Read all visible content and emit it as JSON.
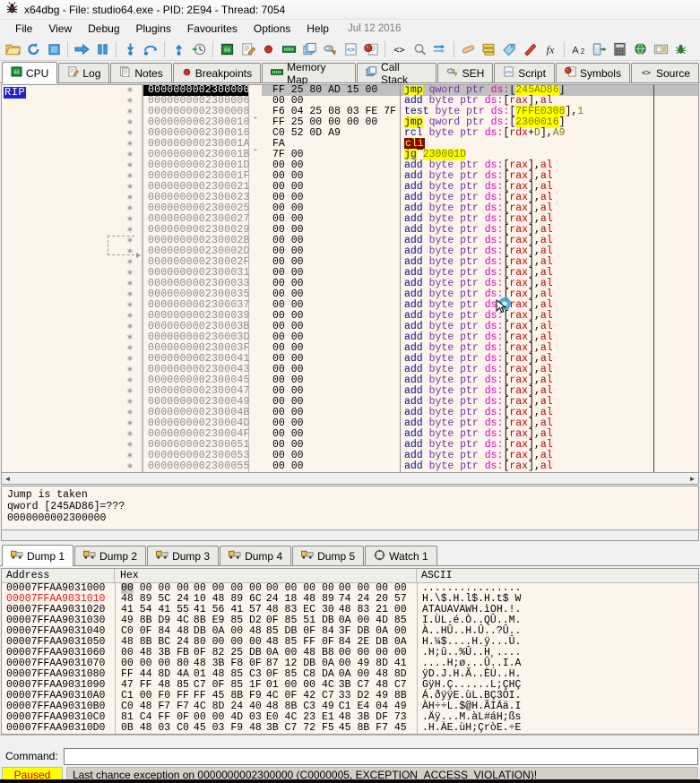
{
  "window": {
    "icon": "bug-icon",
    "title": "x64dbg - File: studio64.exe - PID: 2E94 - Thread: 7054"
  },
  "menu": {
    "items": [
      "File",
      "View",
      "Debug",
      "Plugins",
      "Favourites",
      "Options",
      "Help"
    ],
    "date": "Jul 12 2016"
  },
  "toolbar": {
    "groups": [
      [
        "open-icon",
        "restart-icon",
        "stop-icon"
      ],
      [
        "run-icon",
        "pause-icon"
      ],
      [
        "step-into-icon",
        "step-over-icon"
      ],
      [
        "step-out-icon",
        "run-to-icon"
      ],
      [
        "cpu-icon",
        "log-icon",
        "breakpoints-icon",
        "memory-map-icon",
        "call-stack-icon",
        "seh-icon",
        "script-icon",
        "symbols-icon"
      ],
      [
        "source-icon",
        "references-icon",
        "threads-icon"
      ],
      [
        "patches-icon",
        "comments-icon",
        "labels-icon",
        "bookmarks-icon",
        "functions-icon"
      ],
      [
        "variables-icon",
        "appearance-icon",
        "calculator-icon",
        "web-icon",
        "notes-icon",
        "plugin-icon"
      ]
    ]
  },
  "main_tabs": [
    {
      "label": "CPU",
      "icon": "cpu-icon",
      "active": true
    },
    {
      "label": "Log",
      "icon": "log-icon",
      "active": false
    },
    {
      "label": "Notes",
      "icon": "notes-icon",
      "active": false
    },
    {
      "label": "Breakpoints",
      "icon": "breakpoint-icon",
      "active": false
    },
    {
      "label": "Memory Map",
      "icon": "memory-map-icon",
      "active": false
    },
    {
      "label": "Call Stack",
      "icon": "call-stack-icon",
      "active": false
    },
    {
      "label": "SEH",
      "icon": "seh-icon",
      "active": false
    },
    {
      "label": "Script",
      "icon": "script-icon",
      "active": false
    },
    {
      "label": "Symbols",
      "icon": "symbols-icon",
      "active": false
    },
    {
      "label": "Source",
      "icon": "source-icon",
      "active": false
    }
  ],
  "disassembly": {
    "rip_label": "RIP",
    "rows": [
      {
        "addr": "0000000002300000",
        "hex": "FF 25 80 AD 15 00",
        "selected": true,
        "chev": "",
        "ins_html": "<span class=\"mn-j\">jmp</span> <span class=\"kw\">qword ptr</span> <span class=\"seg\">ds:</span><span class=\"punct\">[</span><span class=\"hl\">245AD86</span><span class=\"punct\">]</span>"
      },
      {
        "addr": "0000000002300006",
        "hex": "00 00",
        "selected": false,
        "chev": "",
        "ins_html": "<span class=\"mn\">add</span> <span class=\"kw\">byte ptr</span> <span class=\"seg\">ds:</span><span class=\"punct\">[</span><span class=\"reg\">rax</span><span class=\"punct\">],</span><span class=\"reg\">al</span>"
      },
      {
        "addr": "0000000002300008",
        "hex": "F6 04 25 08 03 FE 7F",
        "selected": false,
        "chev": "",
        "ins_html": "<span class=\"mn\">test</span> <span class=\"kw\">byte ptr</span> <span class=\"seg\">ds:</span><span class=\"punct\">[</span><span class=\"hl\">7FFE0308</span><span class=\"punct\">],</span><span class=\"num\">1</span>"
      },
      {
        "addr": "0000000002300010",
        "hex": "FF 25 00 00 00 00",
        "selected": false,
        "chev": "v",
        "ins_html": "<span class=\"mn-j\">jmp</span> <span class=\"kw\">qword ptr</span> <span class=\"seg\">ds:</span><span class=\"punct\">[</span><span class=\"hl\">2300016</span><span class=\"punct\">]</span>"
      },
      {
        "addr": "0000000002300016",
        "hex": "C0 52 0D A9",
        "selected": false,
        "chev": "",
        "ins_html": "<span class=\"mn\">rcl</span> <span class=\"kw\">byte ptr</span> <span class=\"seg\">ds:</span><span class=\"punct\">[</span><span class=\"reg\">rdx</span><span class=\"punct\">+</span><span class=\"num\">D</span><span class=\"punct\">],</span><span class=\"num\">A9</span>"
      },
      {
        "addr": "000000000230001A",
        "hex": "FA",
        "selected": false,
        "chev": "",
        "ins_html": "<span class=\"cli\">cli</span>"
      },
      {
        "addr": "000000000230001B",
        "hex": "7F 00",
        "selected": false,
        "chev": "v",
        "ins_html": "<span class=\"jg\">jg</span> <span class=\"jgt\">230001D</span>"
      },
      {
        "addr": "000000000230001D",
        "hex": "00 00",
        "selected": false,
        "chev": "",
        "ins_html": "ADD"
      },
      {
        "addr": "000000000230001F",
        "hex": "00 00",
        "selected": false,
        "chev": "",
        "ins_html": "ADD"
      },
      {
        "addr": "0000000002300021",
        "hex": "00 00",
        "selected": false,
        "chev": "",
        "ins_html": "ADD"
      },
      {
        "addr": "0000000002300023",
        "hex": "00 00",
        "selected": false,
        "chev": "",
        "ins_html": "ADD"
      },
      {
        "addr": "0000000002300025",
        "hex": "00 00",
        "selected": false,
        "chev": "",
        "ins_html": "ADD"
      },
      {
        "addr": "0000000002300027",
        "hex": "00 00",
        "selected": false,
        "chev": "",
        "ins_html": "ADD"
      },
      {
        "addr": "0000000002300029",
        "hex": "00 00",
        "selected": false,
        "chev": "",
        "ins_html": "ADD"
      },
      {
        "addr": "000000000230002B",
        "hex": "00 00",
        "selected": false,
        "chev": "",
        "ins_html": "ADD"
      },
      {
        "addr": "000000000230002D",
        "hex": "00 00",
        "selected": false,
        "chev": "",
        "ins_html": "ADD"
      },
      {
        "addr": "000000000230002F",
        "hex": "00 00",
        "selected": false,
        "chev": "",
        "ins_html": "ADD"
      },
      {
        "addr": "0000000002300031",
        "hex": "00 00",
        "selected": false,
        "chev": "",
        "ins_html": "ADD"
      },
      {
        "addr": "0000000002300033",
        "hex": "00 00",
        "selected": false,
        "chev": "",
        "ins_html": "ADD"
      },
      {
        "addr": "0000000002300035",
        "hex": "00 00",
        "selected": false,
        "chev": "",
        "ins_html": "ADD"
      },
      {
        "addr": "0000000002300037",
        "hex": "00 00",
        "selected": false,
        "chev": "",
        "ins_html": "ADD"
      },
      {
        "addr": "0000000002300039",
        "hex": "00 00",
        "selected": false,
        "chev": "",
        "ins_html": "ADD"
      },
      {
        "addr": "000000000230003B",
        "hex": "00 00",
        "selected": false,
        "chev": "",
        "ins_html": "ADD"
      },
      {
        "addr": "000000000230003D",
        "hex": "00 00",
        "selected": false,
        "chev": "",
        "ins_html": "ADD"
      },
      {
        "addr": "000000000230003F",
        "hex": "00 00",
        "selected": false,
        "chev": "",
        "ins_html": "ADD"
      },
      {
        "addr": "0000000002300041",
        "hex": "00 00",
        "selected": false,
        "chev": "",
        "ins_html": "ADD"
      },
      {
        "addr": "0000000002300043",
        "hex": "00 00",
        "selected": false,
        "chev": "",
        "ins_html": "ADD"
      },
      {
        "addr": "0000000002300045",
        "hex": "00 00",
        "selected": false,
        "chev": "",
        "ins_html": "ADD"
      },
      {
        "addr": "0000000002300047",
        "hex": "00 00",
        "selected": false,
        "chev": "",
        "ins_html": "ADD"
      },
      {
        "addr": "0000000002300049",
        "hex": "00 00",
        "selected": false,
        "chev": "",
        "ins_html": "ADD"
      },
      {
        "addr": "000000000230004B",
        "hex": "00 00",
        "selected": false,
        "chev": "",
        "ins_html": "ADD"
      },
      {
        "addr": "000000000230004D",
        "hex": "00 00",
        "selected": false,
        "chev": "",
        "ins_html": "ADD"
      },
      {
        "addr": "000000000230004F",
        "hex": "00 00",
        "selected": false,
        "chev": "",
        "ins_html": "ADD"
      },
      {
        "addr": "0000000002300051",
        "hex": "00 00",
        "selected": false,
        "chev": "",
        "ins_html": "ADD"
      },
      {
        "addr": "0000000002300053",
        "hex": "00 00",
        "selected": false,
        "chev": "",
        "ins_html": "ADD"
      },
      {
        "addr": "0000000002300055",
        "hex": "00 00",
        "selected": false,
        "chev": "",
        "ins_html": "ADD"
      }
    ],
    "add_instruction_html": "<span class=\"mn\">add</span> <span class=\"kw\">byte ptr</span> <span class=\"seg\">ds:</span><span class=\"punct\">[</span><span class=\"reg\">rax</span><span class=\"punct\">],</span><span class=\"reg\">al</span>"
  },
  "info_panel": {
    "line1": "Jump is taken",
    "line2": "qword [245AD86]=???",
    "line3": "0000000002300000"
  },
  "dump_tabs": [
    {
      "label": "Dump 1",
      "icon": "dump-icon",
      "active": true
    },
    {
      "label": "Dump 2",
      "icon": "dump-icon",
      "active": false
    },
    {
      "label": "Dump 3",
      "icon": "dump-icon",
      "active": false
    },
    {
      "label": "Dump 4",
      "icon": "dump-icon",
      "active": false
    },
    {
      "label": "Dump 5",
      "icon": "dump-icon",
      "active": false
    },
    {
      "label": "Watch 1",
      "icon": "watch-icon",
      "active": false
    }
  ],
  "dump": {
    "headers": {
      "address": "Address",
      "hex": "Hex",
      "ascii": "ASCII"
    },
    "rows": [
      {
        "addr": "00007FFAA9031000",
        "red": false,
        "hex": [
          "00 00 00 00",
          "00 00 00 00",
          "00 00 00 00",
          "00 00 00 00"
        ],
        "ascii": "................"
      },
      {
        "addr": "00007FFAA9031010",
        "red": true,
        "hex": [
          "48 89 5C 24",
          "10 48 89 6C",
          "24 18 48 89",
          "74 24 20 57"
        ],
        "ascii": "H.\\$.H.l$.H.t$ W"
      },
      {
        "addr": "00007FFAA9031020",
        "red": false,
        "hex": [
          "41 54 41 55",
          "41 56 41 57",
          "48 83 EC 30",
          "48 83 21 00"
        ],
        "ascii": "ATAUAVAWH.ìOH.!."
      },
      {
        "addr": "00007FFAA9031030",
        "red": false,
        "hex": [
          "49 8B D9 4C",
          "8B E9 85 D2",
          "0F 85 51 DB",
          "0A 00 4D 85"
        ],
        "ascii": "I.ÙL.é.Ò..QÛ..M."
      },
      {
        "addr": "00007FFAA9031040",
        "red": false,
        "hex": [
          "C0 0F 84 48",
          "DB 0A 00 48",
          "85 DB 0F 84",
          "3F DB 0A 00"
        ],
        "ascii": "À..HÛ..H.Û..?Û.."
      },
      {
        "addr": "00007FFAA9031050",
        "red": false,
        "hex": [
          "48 8B BC 24",
          "80 00 00 00",
          "48 85 FF 0F",
          "84 2E DB 0A"
        ],
        "ascii": "H.¼$....H.ÿ...Û."
      },
      {
        "addr": "00007FFAA9031060",
        "red": false,
        "hex": [
          "00 48 3B FB",
          "0F 82 25 DB",
          "0A 00 48 B8",
          "00 00 00 00"
        ],
        "ascii": ".H;û..%Û..H¸...."
      },
      {
        "addr": "00007FFAA9031070",
        "red": false,
        "hex": [
          "00 00 00 80",
          "48 3B F8 0F",
          "87 12 DB 0A",
          "00 49 8D 41"
        ],
        "ascii": "....H;ø...Û..I.A"
      },
      {
        "addr": "00007FFAA9031080",
        "red": false,
        "hex": [
          "FF 44 8D 4A",
          "01 48 85 C3",
          "0F 85 C8 DA",
          "0A 00 48 8D"
        ],
        "ascii": "ÿD.J.H.Ã..ÈÚ..H."
      },
      {
        "addr": "00007FFAA9031090",
        "red": false,
        "hex": [
          "47 FF 48 85",
          "C7 0F 85 1F",
          "01 00 00 4C",
          "3B C7 48 C7"
        ],
        "ascii": "GÿH.Ç......L;ÇHÇ"
      },
      {
        "addr": "00007FFAA90310A0",
        "red": false,
        "hex": [
          "C1 00 F0 FF",
          "FF 45 8B F9",
          "4C 0F 42 C7",
          "33 D2 49 8B"
        ],
        "ascii": "Á.ðÿÿE.ùL.BÇ3ÒI."
      },
      {
        "addr": "00007FFAA90310B0",
        "red": false,
        "hex": [
          "C0 48 F7 F7",
          "4C 8D 24 40",
          "48 8B C3 49",
          "C1 E4 04 49"
        ],
        "ascii": "ÀH÷÷L.$@H.ÃIÁä.I"
      },
      {
        "addr": "00007FFAA90310C0",
        "red": false,
        "hex": [
          "81 C4 FF 0F",
          "00 00 4D 03",
          "E0 4C 23 E1",
          "48 3B DF 73"
        ],
        "ascii": ".Äÿ...M.àL#áH;ßs"
      },
      {
        "addr": "00007FFAA90310D0",
        "red": false,
        "hex": [
          "0B 48 03 C0",
          "45 03 F9 48",
          "3B C7 72 F5",
          "45 8B F7 45"
        ],
        "ascii": ".H.ÀE.ùH;ÇròE.÷E"
      }
    ]
  },
  "command": {
    "label": "Command:",
    "value": "",
    "placeholder": ""
  },
  "status": {
    "state": "Paused",
    "message": "Last chance exception on 0000000002300000 (C0000005, EXCEPTION_ACCESS_VIOLATION)!"
  },
  "colors": {
    "disasm_bg": "#fdf5ec",
    "selection": "#000000",
    "highlight": "#ffff00",
    "mnemonic": "#0a0a8c",
    "register": "#c00000",
    "segment": "#e000c0",
    "keyword": "#7030a0",
    "paused_text": "#cc0000",
    "dump_red_addr": "#e01b1b"
  }
}
